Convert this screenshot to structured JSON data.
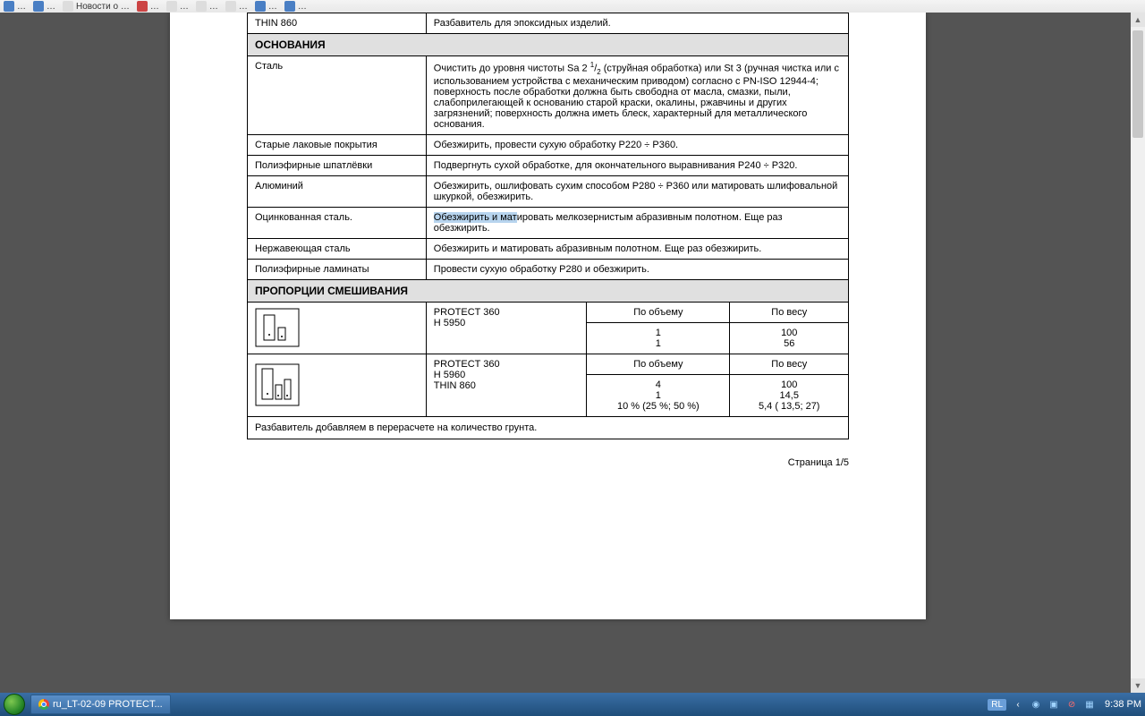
{
  "bookmarks": [
    "...",
    "...",
    "Новости...",
    "...",
    "...",
    "...",
    "...",
    "...",
    "...",
    "..."
  ],
  "taskbar": {
    "title": "ru_LT-02-09 PROTECT...",
    "lang": "RL",
    "clock": "9:38 PM"
  },
  "page_footer": "Страница 1/5",
  "rows": {
    "thin": {
      "name": "THIN 860",
      "desc": "Разбавитель для эпоксидных изделий."
    },
    "section1": "ОСНОВАНИЯ",
    "steel": {
      "name": "Сталь",
      "desc_pre": "Очистить до уровня чистоты Sa 2 ",
      "sup": "1",
      "sub": "2",
      "desc_post": " (струйная обработка) или St 3 (ручная чистка или с использованием устройства с механическим приводом) согласно с PN-ISO 12944-4; поверхность после обработки должна быть свободна от масла, смазки, пыли, слабоприлегающей к основанию старой краски, окалины, ржавчины и других загрязнений; поверхность должна иметь блеск, характерный для металлического основания."
    },
    "old_paint": {
      "name": "Старые лаковые покрытия",
      "desc": "Обезжирить, провести сухую обработку Р220 ÷ Р360."
    },
    "poly_putty": {
      "name": "Полиэфирные шпатлёвки",
      "desc": "Подвергнуть сухой обработке, для окончательного выравнивания Р240 ÷ Р320."
    },
    "aluminum": {
      "name": "Алюминий",
      "desc": "Обезжирить, ошлифовать сухим способом  Р280 ÷ Р360 или матировать шлифовальной шкуркой, обезжирить."
    },
    "galv": {
      "name": "Оцинкованная сталь.",
      "hl1": "Обезжирить",
      "hl2": " и мат",
      "rest": "ировать мелкозернистым абразивным полотном. Еще раз обезжирить."
    },
    "stainless": {
      "name": "Нержавеющая сталь",
      "desc": "Обезжирить и матировать абразивным полотном. Еще раз обезжирить."
    },
    "poly_lam": {
      "name": "Полиэфирные ламинаты",
      "desc": "Провести сухую обработку Р280 и обезжирить."
    },
    "section2": "ПРОПОРЦИИ СМЕШИВАНИЯ",
    "mix_head": {
      "vol": "По объему",
      "wt": "По весу"
    },
    "mix1": {
      "p1": "PROTECT 360",
      "p2": "H 5950",
      "v1": "1",
      "v2": "1",
      "w1": "100",
      "w2": "56"
    },
    "mix2": {
      "p1": "PROTECT 360",
      "p2": "H 5960",
      "p3": "THIN 860",
      "v1": "4",
      "v2": "1",
      "v3": "10 % (25 %; 50 %)",
      "w1": "100",
      "w2": "14,5",
      "w3": "5,4 ( 13,5; 27)"
    },
    "footnote": "Разбавитель добавляем в перерасчете на количество грунта."
  }
}
